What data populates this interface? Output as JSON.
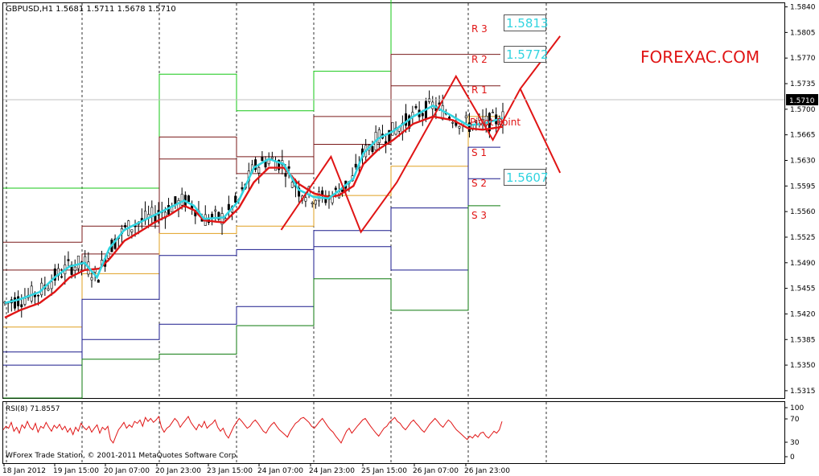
{
  "header": {
    "symbol_info": "GBPUSD,H1  1.5681 1.5711 1.5678 1.5710",
    "watermark": "FOREXAC.COM",
    "copyright": "WForex Trade Station, © 2001-2011 MetaQuotes Software Corp."
  },
  "colors": {
    "r3": "#16c716",
    "r2": "#7a1a1a",
    "r1": "#7a1a1a",
    "pivot": "#e0a020",
    "s1": "#1a1a8c",
    "s2": "#1a1a8c",
    "s3": "#0d7a0d",
    "ema_fast": "#32d4e0",
    "ema_slow": "#e01515",
    "zigzag": "#e01515",
    "candles": "#000000",
    "rsi": "#e01515",
    "watermark": "#e01515"
  },
  "level_labels": {
    "r3": "R 3",
    "r2": "R 2",
    "r1": "R 1",
    "pivot": "Pivot Point",
    "s1": "S 1",
    "s2": "S 2",
    "s3": "S 3"
  },
  "price_boxes": [
    "1.5813",
    "1.5772",
    "1.5607"
  ],
  "current_price": "1.5710",
  "rsi": {
    "label": "RSI(8) 71.8557",
    "ticks": [
      "100",
      "70",
      "30",
      "0"
    ]
  },
  "chart_data": {
    "type": "candlestick",
    "y_ticks": [
      "1.5840",
      "1.5805",
      "1.5770",
      "1.5735",
      "1.5700",
      "1.5665",
      "1.5630",
      "1.5595",
      "1.5560",
      "1.5525",
      "1.5490",
      "1.5455",
      "1.5420",
      "1.5385",
      "1.5350",
      "1.5315"
    ],
    "ylim": [
      1.5305,
      1.5845
    ],
    "current_price": 1.571,
    "x_labels": [
      "18 Jan 2012",
      "19 Jan 15:00",
      "20 Jan 07:00",
      "20 Jan 23:00",
      "23 Jan 15:00",
      "24 Jan 07:00",
      "24 Jan 23:00",
      "25 Jan 15:00",
      "26 Jan 07:00",
      "26 Jan 23:00"
    ],
    "pivot_levels": {
      "r3": [
        1.5592,
        1.5592,
        1.5748,
        1.5698,
        1.5752,
        1.585,
        1.585
      ],
      "r2": [
        1.5518,
        1.554,
        1.5662,
        1.5635,
        1.569,
        1.5775,
        1.5775
      ],
      "r1": [
        1.548,
        1.5502,
        1.5632,
        1.5612,
        1.5652,
        1.5732,
        1.5732
      ],
      "pivot": [
        1.5402,
        1.5475,
        1.553,
        1.554,
        1.5582,
        1.5622,
        1.569
      ],
      "s1": [
        1.5368,
        1.544,
        1.55,
        1.5508,
        1.5534,
        1.5565,
        1.5648
      ],
      "s2": [
        1.535,
        1.5385,
        1.5406,
        1.543,
        1.5512,
        1.548,
        1.5605
      ],
      "s3": [
        1.5305,
        1.5358,
        1.5365,
        1.5404,
        1.5468,
        1.5425,
        1.5568
      ]
    },
    "ema_fast_anchors": [
      [
        0,
        1.5435
      ],
      [
        0.03,
        1.544
      ],
      [
        0.07,
        1.545
      ],
      [
        0.1,
        1.547
      ],
      [
        0.13,
        1.5485
      ],
      [
        0.16,
        1.549
      ],
      [
        0.185,
        1.547
      ],
      [
        0.21,
        1.551
      ],
      [
        0.24,
        1.5535
      ],
      [
        0.27,
        1.5545
      ],
      [
        0.3,
        1.5555
      ],
      [
        0.33,
        1.5565
      ],
      [
        0.36,
        1.5575
      ],
      [
        0.38,
        1.5568
      ],
      [
        0.4,
        1.555
      ],
      [
        0.44,
        1.5552
      ],
      [
        0.47,
        1.5575
      ],
      [
        0.5,
        1.562
      ],
      [
        0.53,
        1.5632
      ],
      [
        0.56,
        1.5625
      ],
      [
        0.59,
        1.559
      ],
      [
        0.62,
        1.558
      ],
      [
        0.65,
        1.5578
      ],
      [
        0.67,
        1.5588
      ],
      [
        0.7,
        1.5605
      ],
      [
        0.72,
        1.564
      ],
      [
        0.75,
        1.566
      ],
      [
        0.78,
        1.567
      ],
      [
        0.82,
        1.569
      ],
      [
        0.86,
        1.5705
      ],
      [
        0.9,
        1.569
      ],
      [
        0.93,
        1.5678
      ],
      [
        0.96,
        1.568
      ],
      [
        1.0,
        1.5688
      ]
    ],
    "ema_slow_anchors": [
      [
        0,
        1.5415
      ],
      [
        0.03,
        1.5425
      ],
      [
        0.07,
        1.5435
      ],
      [
        0.1,
        1.545
      ],
      [
        0.13,
        1.547
      ],
      [
        0.16,
        1.548
      ],
      [
        0.19,
        1.5482
      ],
      [
        0.21,
        1.5495
      ],
      [
        0.24,
        1.552
      ],
      [
        0.27,
        1.5532
      ],
      [
        0.3,
        1.5545
      ],
      [
        0.33,
        1.5555
      ],
      [
        0.36,
        1.5568
      ],
      [
        0.38,
        1.5562
      ],
      [
        0.4,
        1.5548
      ],
      [
        0.44,
        1.5545
      ],
      [
        0.47,
        1.5565
      ],
      [
        0.5,
        1.56
      ],
      [
        0.53,
        1.562
      ],
      [
        0.56,
        1.562
      ],
      [
        0.59,
        1.5598
      ],
      [
        0.62,
        1.5585
      ],
      [
        0.65,
        1.558
      ],
      [
        0.67,
        1.5582
      ],
      [
        0.7,
        1.5595
      ],
      [
        0.72,
        1.5625
      ],
      [
        0.75,
        1.5645
      ],
      [
        0.78,
        1.5658
      ],
      [
        0.82,
        1.568
      ],
      [
        0.86,
        1.569
      ],
      [
        0.9,
        1.5685
      ],
      [
        0.93,
        1.5674
      ],
      [
        0.96,
        1.5672
      ],
      [
        1.0,
        1.5676
      ]
    ],
    "zigzag": [
      [
        0.555,
        1.5535
      ],
      [
        0.655,
        1.5635
      ],
      [
        0.715,
        1.5532
      ],
      [
        0.787,
        1.56
      ],
      [
        0.906,
        1.5745
      ],
      [
        0.98,
        1.5658
      ],
      [
        1.035,
        1.5728
      ],
      [
        1.115,
        1.58
      ]
    ],
    "zigzag_down": [
      [
        1.035,
        1.5728
      ],
      [
        1.115,
        1.5613
      ]
    ],
    "rsi_values": [
      55,
      62,
      58,
      70,
      52,
      60,
      48,
      65,
      58,
      72,
      60,
      55,
      68,
      50,
      62,
      58,
      70,
      60,
      52,
      64,
      58,
      66,
      55,
      62,
      50,
      58,
      45,
      60,
      52,
      68,
      60,
      55,
      62,
      50,
      58,
      65,
      48,
      60,
      55,
      62,
      35,
      28,
      42,
      55,
      62,
      70,
      58,
      65,
      60,
      72,
      68,
      75,
      62,
      80,
      72,
      78,
      70,
      75,
      82,
      60,
      50,
      58,
      62,
      70,
      78,
      72,
      60,
      68,
      75,
      82,
      70,
      62,
      55,
      66,
      60,
      72,
      58,
      64,
      68,
      75,
      60,
      52,
      58,
      45,
      38,
      50,
      62,
      70,
      78,
      72,
      65,
      58,
      62,
      70,
      75,
      68,
      60,
      52,
      48,
      58,
      65,
      70,
      62,
      55,
      50,
      45,
      40,
      52,
      60,
      68,
      72,
      78,
      80,
      75,
      70,
      62,
      58,
      65,
      72,
      78,
      70,
      62,
      55,
      50,
      42,
      35,
      28,
      40,
      52,
      58,
      48,
      55,
      62,
      68,
      75,
      78,
      70,
      62,
      55,
      48,
      42,
      50,
      58,
      62,
      70,
      75,
      80,
      72,
      68,
      60,
      55,
      62,
      70,
      75,
      68,
      62,
      55,
      50,
      58,
      66,
      72,
      78,
      72,
      65,
      60,
      68,
      75,
      70,
      62,
      55,
      50,
      45,
      40,
      35,
      42,
      38,
      45,
      40,
      48,
      50,
      42,
      38,
      45,
      52,
      48,
      55,
      72
    ]
  }
}
